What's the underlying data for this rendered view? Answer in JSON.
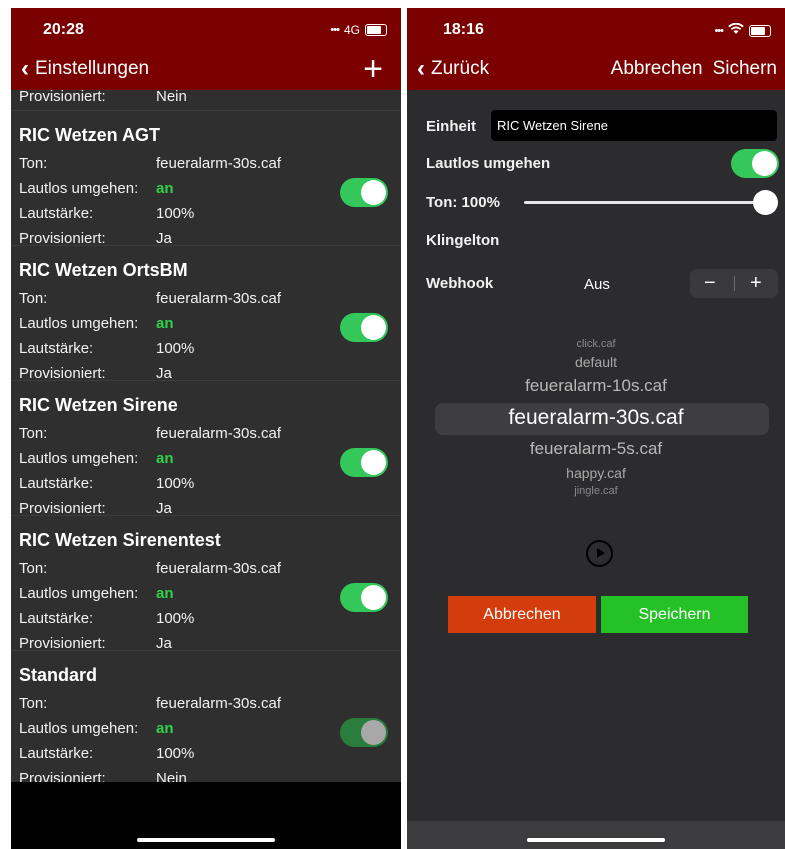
{
  "left": {
    "status": {
      "time": "20:28",
      "signal": "•••",
      "network": "4G"
    },
    "nav": {
      "back_label": "Einstellungen",
      "add_label": "+"
    },
    "partial_row": {
      "label": "Provisioniert:",
      "value": "Nein"
    },
    "labels": {
      "ton": "Ton:",
      "lautlos": "Lautlos umgehen:",
      "lautstaerke": "Lautstärke:",
      "provisioniert": "Provisioniert:"
    },
    "items": [
      {
        "title": "RIC Wetzen AGT",
        "ton": "feueralarm-30s.caf",
        "lautlos": "an",
        "lautstaerke": "100%",
        "provisioniert": "Ja",
        "toggle": "on"
      },
      {
        "title": "RIC Wetzen OrtsBM",
        "ton": "feueralarm-30s.caf",
        "lautlos": "an",
        "lautstaerke": "100%",
        "provisioniert": "Ja",
        "toggle": "on"
      },
      {
        "title": "RIC Wetzen Sirene",
        "ton": "feueralarm-30s.caf",
        "lautlos": "an",
        "lautstaerke": "100%",
        "provisioniert": "Ja",
        "toggle": "on"
      },
      {
        "title": "RIC Wetzen Sirenentest",
        "ton": "feueralarm-30s.caf",
        "lautlos": "an",
        "lautstaerke": "100%",
        "provisioniert": "Ja",
        "toggle": "on"
      },
      {
        "title": "Standard",
        "ton": "feueralarm-30s.caf",
        "lautlos": "an",
        "lautstaerke": "100%",
        "provisioniert": "Nein",
        "toggle": "on-disabled"
      }
    ]
  },
  "right": {
    "status": {
      "time": "18:16",
      "signal": "•••"
    },
    "nav": {
      "back_label": "Zurück",
      "cancel_label": "Abbrechen",
      "save_label": "Sichern"
    },
    "einheit": {
      "label": "Einheit",
      "value": "RIC Wetzen Sirene"
    },
    "lautlos": {
      "label": "Lautlos umgehen",
      "toggle": "on"
    },
    "ton": {
      "label": "Ton: 100%",
      "level": 1.0
    },
    "klingelton": {
      "label": "Klingelton"
    },
    "webhook": {
      "label": "Webhook",
      "value": "Aus",
      "minus": "−",
      "plus": "+"
    },
    "picker": {
      "options": [
        "click.caf",
        "default",
        "feueralarm-10s.caf",
        "feueralarm-30s.caf",
        "feueralarm-5s.caf",
        "happy.caf",
        "jingle.caf"
      ],
      "selected": "feueralarm-30s.caf"
    },
    "buttons": {
      "cancel": "Abbrechen",
      "save": "Speichern"
    }
  },
  "colors": {
    "nav_red": "#7b0000",
    "toggle_green": "#34c759",
    "cancel_orange": "#d33d0c",
    "save_green": "#25c227"
  }
}
